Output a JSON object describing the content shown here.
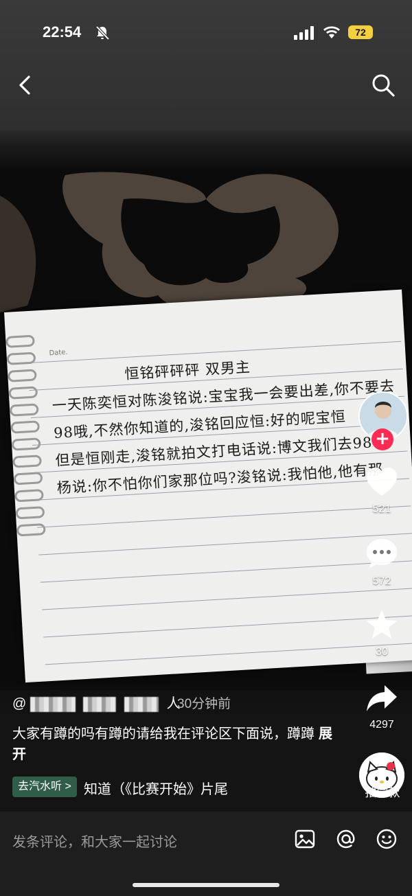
{
  "status_bar": {
    "time": "22:54",
    "battery": "72"
  },
  "video": {
    "note_lines": [
      "Date.",
      "恒铭砰砰砰    双男主",
      "一天陈奕恒对陈浚铭说:宝宝我一会要出差,你不要去",
      "98哦,不然你知道的,浚铭回应恒:好的呢宝恒",
      "但是恒刚走,浚铭就拍文打电话说:博文我们去98",
      "杨说:你不怕你们家那位吗?浚铭说:我怕他,他有那"
    ]
  },
  "actions": {
    "likes": "521",
    "comments": "572",
    "favorites": "30",
    "shares": "4297",
    "same_style_label": "拍同款"
  },
  "post": {
    "author_suffix": "人",
    "time_ago": "30分钟前",
    "caption": "大家有蹲的吗有蹲的请给我在评论区下面说，蹲蹲",
    "expand_label": "展开",
    "music_chip": "去汽水听 >",
    "music_title": "知道（《比赛开始》片尾"
  },
  "comment_bar": {
    "placeholder": "发条评论，和大家一起讨论"
  },
  "colors": {
    "accent": "#fe2c55",
    "battery": "#f4d03f",
    "music_chip": "#2f5d49"
  }
}
